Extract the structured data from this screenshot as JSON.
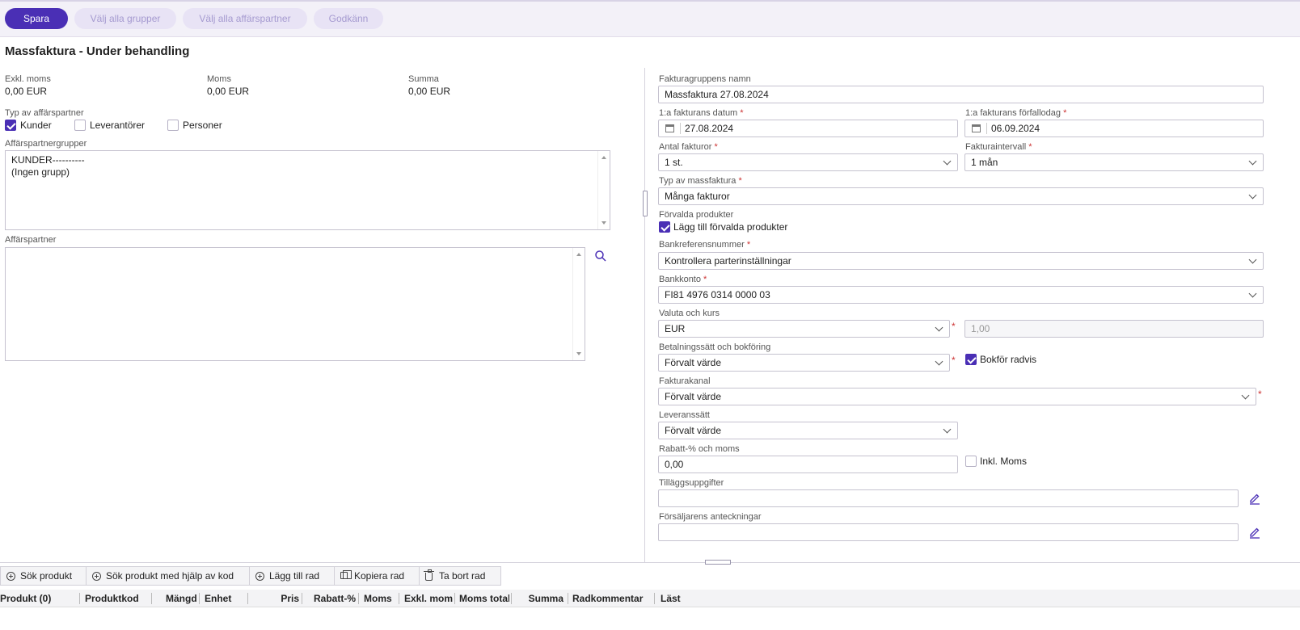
{
  "toolbar": {
    "save": "Spara",
    "select_groups": "Välj alla grupper",
    "select_partners": "Välj alla affärspartner",
    "approve": "Godkänn"
  },
  "page_title": "Massfaktura - Under behandling",
  "totals": {
    "excl_label": "Exkl. moms",
    "excl_value": "0,00 EUR",
    "vat_label": "Moms",
    "vat_value": "0,00 EUR",
    "sum_label": "Summa",
    "sum_value": "0,00 EUR"
  },
  "partner_type": {
    "label": "Typ av affärspartner",
    "customers": "Kunder",
    "customers_checked": true,
    "suppliers": "Leverantörer",
    "suppliers_checked": false,
    "persons": "Personer",
    "persons_checked": false
  },
  "partner_groups": {
    "label": "Affärspartnergrupper",
    "lines": [
      "KUNDER----------",
      "(Ingen grupp)"
    ]
  },
  "partners": {
    "label": "Affärspartner"
  },
  "form": {
    "group_name_label": "Fakturagruppens namn",
    "group_name_value": "Massfaktura 27.08.2024",
    "first_date_label": "1:a fakturans datum",
    "first_date_value": "27.08.2024",
    "first_due_label": "1:a fakturans förfallodag",
    "first_due_value": "06.09.2024",
    "count_label": "Antal fakturor",
    "count_value": "1 st.",
    "interval_label": "Fakturaintervall",
    "interval_value": "1 mån",
    "type_label": "Typ av massfaktura",
    "type_value": "Många fakturor",
    "default_products_label": "Förvalda produkter",
    "default_products_check": "Lägg till förvalda produkter",
    "bankref_label": "Bankreferensnummer",
    "bankref_value": "Kontrollera parterinställningar",
    "bankaccount_label": "Bankkonto",
    "bankaccount_value": "FI81 4976 0314 0000 03",
    "currency_label": "Valuta och kurs",
    "currency_value": "EUR",
    "rate_value": "1,00",
    "payment_label": "Betalningssätt och bokföring",
    "payment_value": "Förvalt värde",
    "book_rows": "Bokför radvis",
    "channel_label": "Fakturakanal",
    "channel_value": "Förvalt värde",
    "delivery_label": "Leveranssätt",
    "delivery_value": "Förvalt värde",
    "discount_label": "Rabatt-% och moms",
    "discount_value": "0,00",
    "incl_vat": "Inkl. Moms",
    "extra_label": "Tilläggsuppgifter",
    "seller_notes_label": "Försäljarens anteckningar"
  },
  "row_toolbar": {
    "search_product": "Sök produkt",
    "search_by_code": "Sök produkt med hjälp av kod",
    "add_row": "Lägg till rad",
    "copy_row": "Kopiera rad",
    "delete_row": "Ta bort rad"
  },
  "grid_columns": [
    "Produkt (0)",
    "Produktkod",
    "Mängd",
    "Enhet",
    "Pris",
    "Rabatt-%",
    "Moms",
    "Exkl. moms",
    "Moms total",
    "Summa",
    "Radkommentar",
    "Läst"
  ],
  "colors": {
    "accent": "#4a2fb5",
    "required": "#cc3333"
  }
}
